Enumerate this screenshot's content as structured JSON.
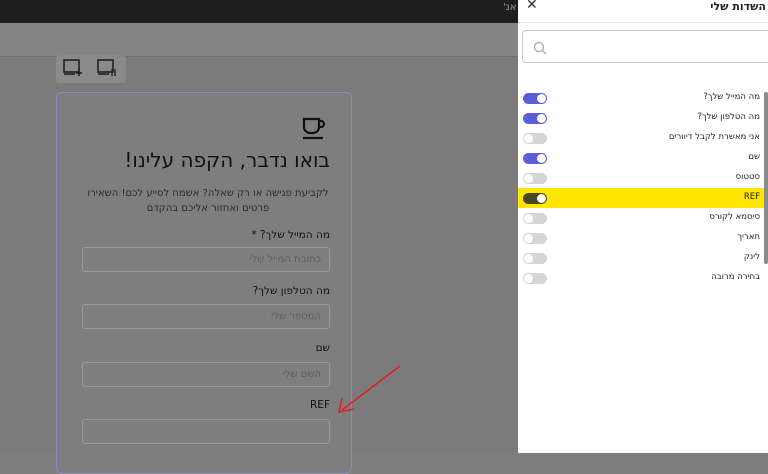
{
  "topbar": {
    "text": "אנ'"
  },
  "form": {
    "title": "בואו נדבר, הקפה עלינו!",
    "description": "לקביעת פגישה או רק שאלה? אשמח לסייע לכם! השאירו פרטים ואחזור אליכם בהקדם",
    "fields": [
      {
        "label": "מה המייל שלך? *",
        "placeholder": "כתובת המייל שלי"
      },
      {
        "label": "מה הטלפון שלך?",
        "placeholder": "המספר שלי"
      },
      {
        "label": "שם",
        "placeholder": "השם שלי"
      },
      {
        "label": "REF",
        "placeholder": ""
      }
    ]
  },
  "panel": {
    "title": "השדות שלי",
    "close_icon": "close-icon",
    "search": {
      "placeholder": "",
      "icon": "search-icon"
    },
    "fields": [
      {
        "label": "מה המייל שלך?",
        "enabled": true
      },
      {
        "label": "מה הטלפון שלך?",
        "enabled": true
      },
      {
        "label": "אני מאשרת לקבל דיוורים",
        "enabled": false
      },
      {
        "label": "שם",
        "enabled": true
      },
      {
        "label": "סטטוס",
        "enabled": false
      },
      {
        "label": "REF",
        "enabled": true,
        "highlighted": true
      },
      {
        "label": "סיסמא לקורס",
        "enabled": false
      },
      {
        "label": "תאריך",
        "enabled": false
      },
      {
        "label": "לינק",
        "enabled": false
      },
      {
        "label": "בחירה מרובה",
        "enabled": false
      }
    ]
  },
  "colors": {
    "toggle_on": "#5b5fd6",
    "highlight": "#ffe600",
    "card_border": "#8a8dc4",
    "arrow": "#e02020"
  }
}
